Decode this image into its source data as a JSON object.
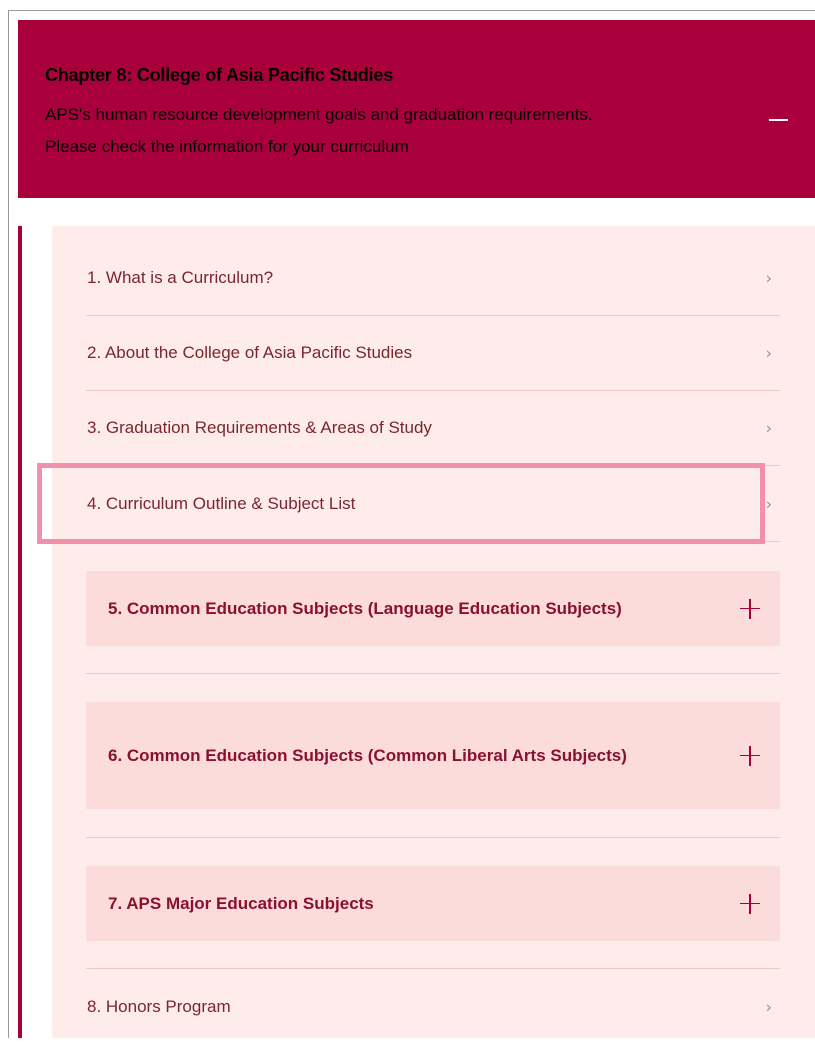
{
  "chapter": {
    "title": "Chapter 8: College of Asia Pacific Studies",
    "description_line1": "APS's human resource development goals and graduation requirements.",
    "description_line2": "Please check the information for your curriculum",
    "collapse_icon": "minus-icon"
  },
  "items": [
    {
      "label": "1. What is a Curriculum?",
      "icon": "chevron-right-icon"
    },
    {
      "label": "2. About the College of Asia Pacific Studies",
      "icon": "chevron-right-icon"
    },
    {
      "label": "3. Graduation Requirements & Areas of Study",
      "icon": "chevron-right-icon"
    },
    {
      "label": "4. Curriculum Outline & Subject List",
      "icon": "chevron-right-icon",
      "highlighted": true
    },
    {
      "label": "5. Common Education Subjects (Language Education Subjects)",
      "icon": "plus-icon",
      "expandable": true
    },
    {
      "label": "6. Common Education Subjects (Common Liberal Arts Subjects)",
      "icon": "plus-icon",
      "expandable": true
    },
    {
      "label": "7. APS Major Education Subjects",
      "icon": "plus-icon",
      "expandable": true
    },
    {
      "label": "8. Honors Program",
      "icon": "chevron-right-icon"
    }
  ],
  "glyphs": {
    "chevron": "›"
  },
  "colors": {
    "brand": "#a9003c",
    "panel_bg": "#fdecea",
    "section_bg": "#fcdcda",
    "highlight": "#f28fad"
  }
}
